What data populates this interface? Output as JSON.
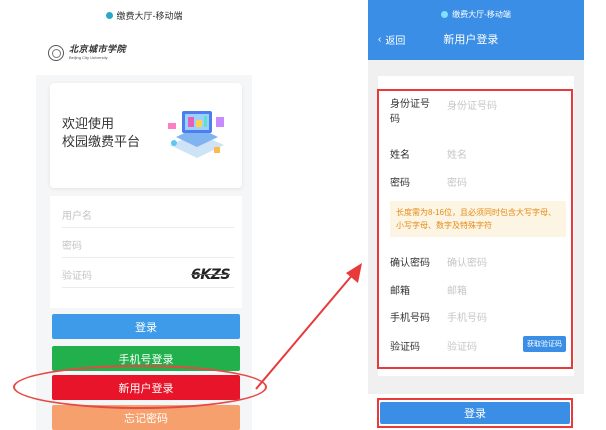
{
  "left": {
    "status_title": "缴费大厅-移动端",
    "logo_cn": "北京城市学院",
    "logo_en": "Beijing City University",
    "welcome_line1": "欢迎使用",
    "welcome_line2": "校园缴费平台",
    "username_placeholder": "用户名",
    "password_placeholder": "密码",
    "captcha_placeholder": "验证码",
    "captcha_image_text": "6KZS",
    "btn_login": "登录",
    "btn_phone_login": "手机号登录",
    "btn_new_user": "新用户登录",
    "btn_forgot": "忘记密码"
  },
  "right": {
    "status_title": "缴费大厅-移动端",
    "back_label": "返回",
    "nav_title": "新用户登录",
    "fields": {
      "id_label": "身份证号码",
      "id_placeholder": "身份证号码",
      "name_label": "姓名",
      "name_placeholder": "姓名",
      "password_label": "密码",
      "password_placeholder": "密码",
      "tip": "长度需为8-16位，且必须同时包含大写字母、小写字母、数字及特殊字符",
      "confirm_label": "确认密码",
      "confirm_placeholder": "确认密码",
      "email_label": "邮箱",
      "email_placeholder": "邮箱",
      "phone_label": "手机号码",
      "phone_placeholder": "手机号码",
      "code_label": "验证码",
      "code_placeholder": "验证码",
      "get_code_button": "获取验证码"
    },
    "btn_login": "登录"
  },
  "colors": {
    "blue": "#3a8ee6",
    "green": "#21b04b",
    "red": "#e8152a",
    "orange": "#f6a06e",
    "annotation_red": "#e83a3a"
  }
}
